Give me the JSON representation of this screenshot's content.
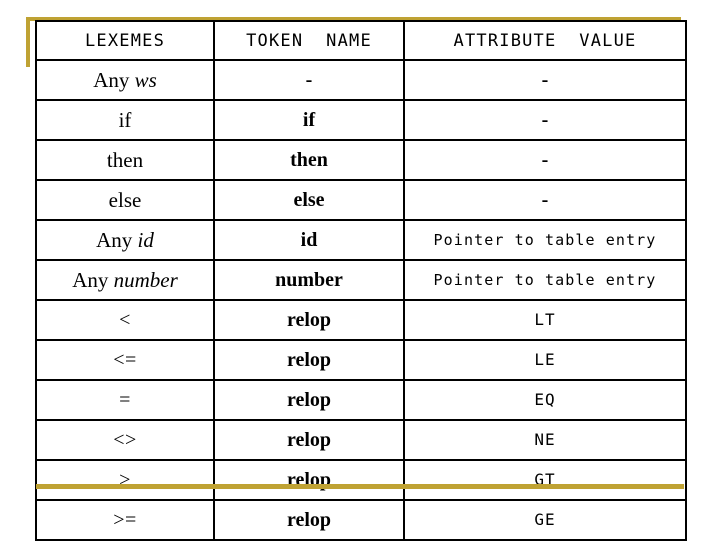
{
  "slide": {
    "accent_color": "#bfa233",
    "border_color": "#000000",
    "background_color": "#ffffff"
  },
  "table": {
    "headers": {
      "lexemes": "LEXEMES",
      "token_name": "TOKEN  NAME",
      "attribute_value": "ATTRIBUTE  VALUE"
    },
    "rows": [
      {
        "lexeme_prefix": "Any ",
        "lexeme_italic": "ws",
        "token_name": "-",
        "token_style": "dash",
        "attribute_value": "-",
        "attribute_style": "dash"
      },
      {
        "lexeme_prefix": "if",
        "lexeme_italic": "",
        "token_name": "if",
        "token_style": "bold",
        "attribute_value": "-",
        "attribute_style": "dash"
      },
      {
        "lexeme_prefix": "then",
        "lexeme_italic": "",
        "token_name": "then",
        "token_style": "bold",
        "attribute_value": "-",
        "attribute_style": "dash"
      },
      {
        "lexeme_prefix": "else",
        "lexeme_italic": "",
        "token_name": "else",
        "token_style": "bold",
        "attribute_value": "-",
        "attribute_style": "dash"
      },
      {
        "lexeme_prefix": "Any ",
        "lexeme_italic": "id",
        "token_name": "id",
        "token_style": "bold",
        "attribute_value": "Pointer to table entry",
        "attribute_style": "mono"
      },
      {
        "lexeme_prefix": "Any ",
        "lexeme_italic": "number",
        "token_name": "number",
        "token_style": "bold",
        "attribute_value": "Pointer to table entry",
        "attribute_style": "mono"
      },
      {
        "lexeme_prefix": "<",
        "lexeme_italic": "",
        "token_name": "relop",
        "token_style": "bold",
        "attribute_value": "LT",
        "attribute_style": "code"
      },
      {
        "lexeme_prefix": "<=",
        "lexeme_italic": "",
        "token_name": "relop",
        "token_style": "bold",
        "attribute_value": "LE",
        "attribute_style": "code"
      },
      {
        "lexeme_prefix": "=",
        "lexeme_italic": "",
        "token_name": "relop",
        "token_style": "bold",
        "attribute_value": "EQ",
        "attribute_style": "code"
      },
      {
        "lexeme_prefix": "<>",
        "lexeme_italic": "",
        "token_name": "relop",
        "token_style": "bold",
        "attribute_value": "NE",
        "attribute_style": "code"
      },
      {
        "lexeme_prefix": ">",
        "lexeme_italic": "",
        "token_name": "relop",
        "token_style": "bold",
        "attribute_value": "GT",
        "attribute_style": "code"
      },
      {
        "lexeme_prefix": ">=",
        "lexeme_italic": "",
        "token_name": "relop",
        "token_style": "bold",
        "attribute_value": "GE",
        "attribute_style": "code"
      }
    ]
  }
}
